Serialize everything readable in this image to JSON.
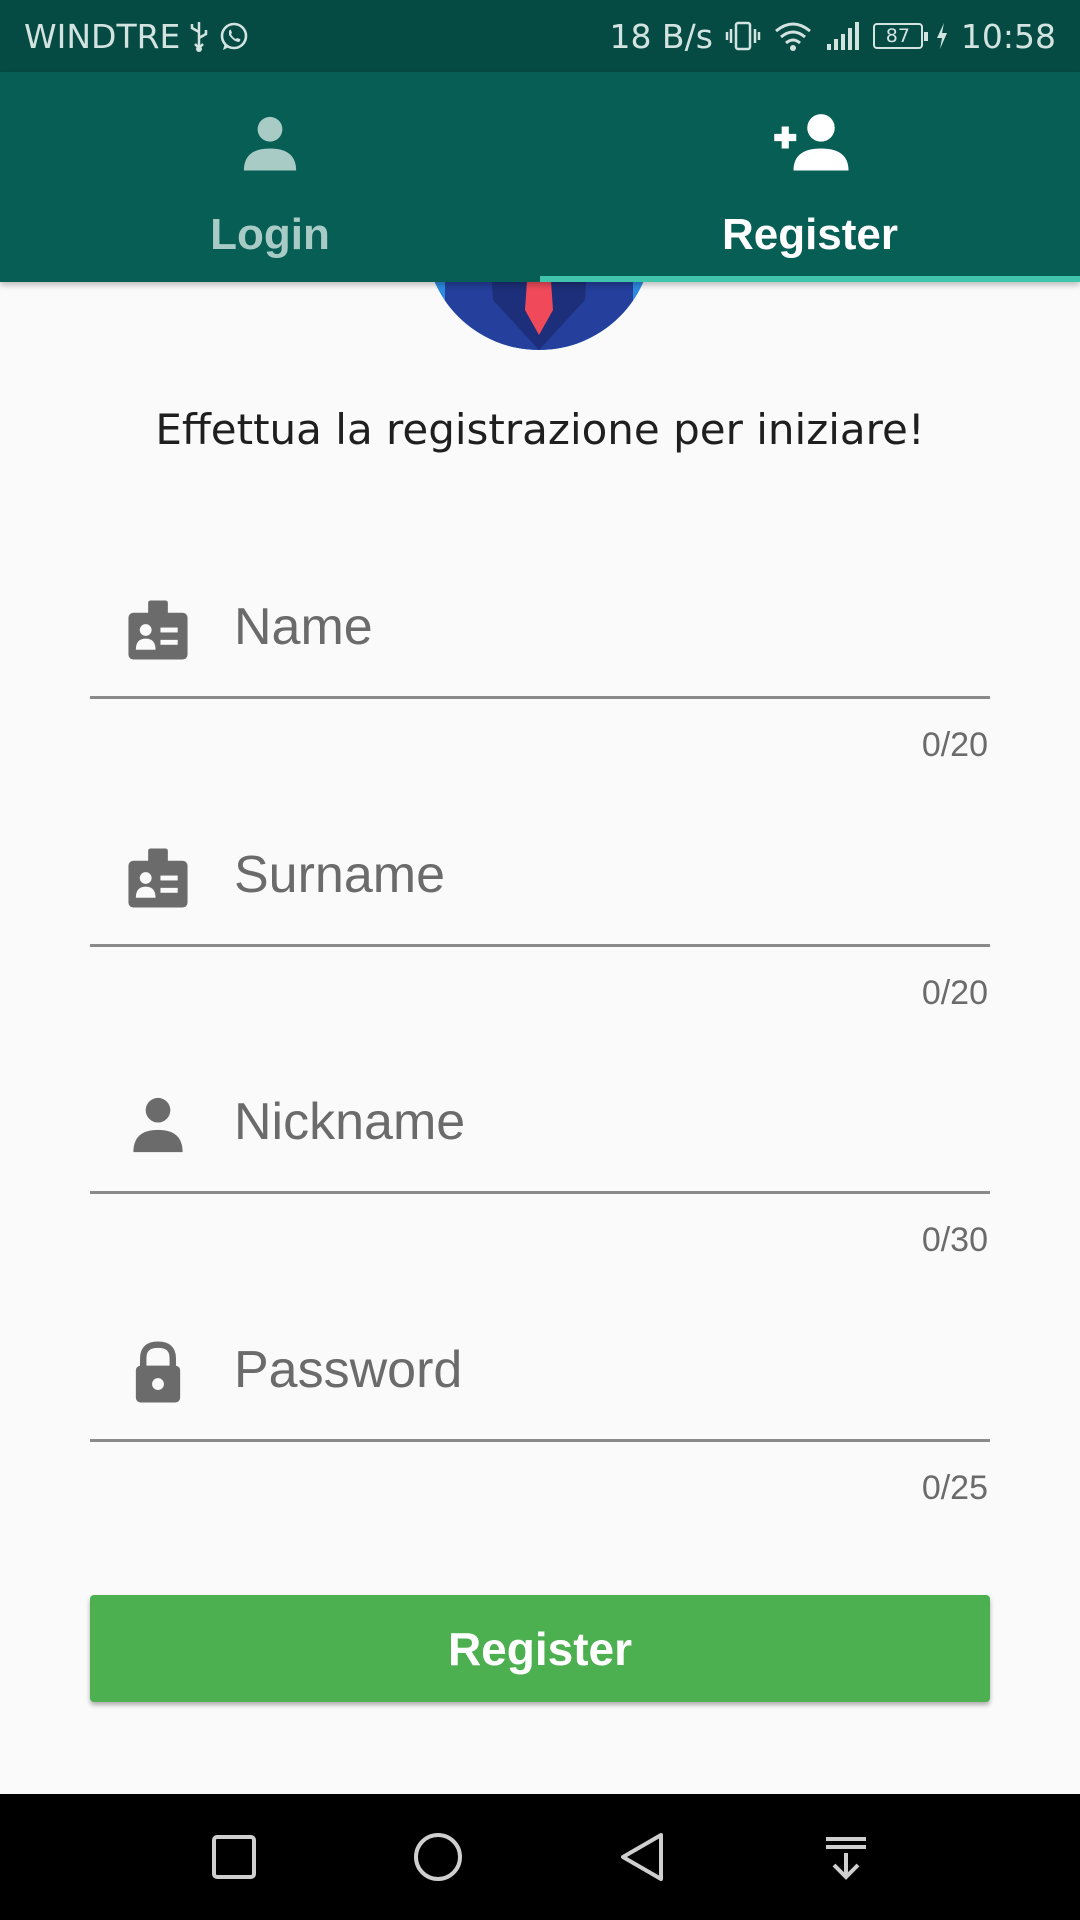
{
  "status_bar": {
    "carrier": "WINDTRE",
    "network_speed": "18 B/s",
    "battery_level": "87",
    "time": "10:58"
  },
  "tabs": {
    "login_label": "Login",
    "register_label": "Register",
    "selected": "Register"
  },
  "form": {
    "subtitle": "Effettua la registrazione per iniziare!",
    "fields": [
      {
        "placeholder": "Name",
        "counter": "0/20",
        "icon": "badge-icon"
      },
      {
        "placeholder": "Surname",
        "counter": "0/20",
        "icon": "badge-icon"
      },
      {
        "placeholder": "Nickname",
        "counter": "0/30",
        "icon": "person-icon"
      },
      {
        "placeholder": "Password",
        "counter": "0/25",
        "icon": "lock-icon"
      }
    ],
    "submit_label": "Register"
  },
  "colors": {
    "status_bar": "#064a44",
    "tab_bar": "#075e55",
    "tab_indicator": "#40c4ab",
    "button": "#4caf50",
    "background": "#fafafa"
  }
}
